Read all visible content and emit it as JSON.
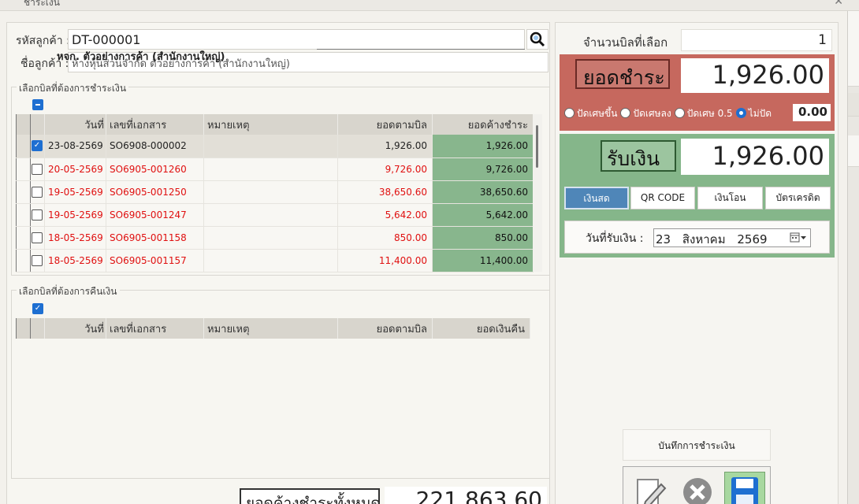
{
  "window": {
    "title": "ชำระเงิน"
  },
  "customer": {
    "code_label": "รหัสลูกค้า :",
    "code_value": "DT-000001",
    "name_label": "ชื่อลูกค้า :",
    "name_value": "ห้างหุ้นส่วนจำกัด ตัวอย่างการค้า (สำนักงานใหญ่)",
    "name_overlay": "หจก. ตัวอย่างการค้า (สำนักงานใหญ่)"
  },
  "pay_bills": {
    "title": "เลือกบิลที่ต้องการชำระเงิน",
    "columns": [
      "วันที่",
      "เลขที่เอกสาร",
      "หมายเหตุ",
      "ยอดตามบิล",
      "ยอดค้างชำระ"
    ],
    "rows": [
      {
        "checked": true,
        "date": "23-08-2569",
        "doc": "SO6908-000002",
        "note": "",
        "bill": "1,926.00",
        "outstanding": "1,926.00",
        "highlight": false
      },
      {
        "checked": false,
        "date": "20-05-2569",
        "doc": "SO6905-001260",
        "note": "",
        "bill": "9,726.00",
        "outstanding": "9,726.00",
        "highlight": true
      },
      {
        "checked": false,
        "date": "19-05-2569",
        "doc": "SO6905-001250",
        "note": "",
        "bill": "38,650.60",
        "outstanding": "38,650.60",
        "highlight": true
      },
      {
        "checked": false,
        "date": "19-05-2569",
        "doc": "SO6905-001247",
        "note": "",
        "bill": "5,642.00",
        "outstanding": "5,642.00",
        "highlight": true
      },
      {
        "checked": false,
        "date": "18-05-2569",
        "doc": "SO6905-001158",
        "note": "",
        "bill": "850.00",
        "outstanding": "850.00",
        "highlight": true
      },
      {
        "checked": false,
        "date": "18-05-2569",
        "doc": "SO6905-001157",
        "note": "",
        "bill": "11,400.00",
        "outstanding": "11,400.00",
        "highlight": true
      }
    ]
  },
  "refund_bills": {
    "title": "เลือกบิลที่ต้องการคืนเงิน",
    "columns": [
      "วันที่",
      "เลขที่เอกสาร",
      "หมายเหตุ",
      "ยอดตามบิล",
      "ยอดเงินคืน"
    ]
  },
  "total": {
    "label": "ยอดค้างชำระทั้งหมด",
    "value": "221,863.60"
  },
  "summary": {
    "count_label": "จำนวนบิลที่เลือก",
    "count_value": "1",
    "pay_label": "ยอดชำระ",
    "pay_value": "1,926.00",
    "rounding": {
      "options": [
        "ปัดเศษขึ้น",
        "ปัดเศษลง",
        "ปัดเศษ 0.5",
        "ไม่ปัด"
      ],
      "selected_index": 3,
      "value": "0.00"
    },
    "receive_label": "รับเงิน",
    "receive_value": "1,926.00",
    "methods": [
      "เงินสด",
      "QR CODE",
      "เงินโอน",
      "บัตรเครดิต"
    ],
    "active_method": 0,
    "date_label": "วันที่รับเงิน :",
    "date_day": "23",
    "date_month": "สิงหาคม",
    "date_year": "2569"
  },
  "actions": {
    "record_label": "บันทึกการชำระเงิน"
  },
  "colors": {
    "pay_red": "#c6685e",
    "receive_green": "#85b68a",
    "outstanding_cell": "#88b68d",
    "active_method": "#4f86b8",
    "overdue_text": "#e01010"
  }
}
